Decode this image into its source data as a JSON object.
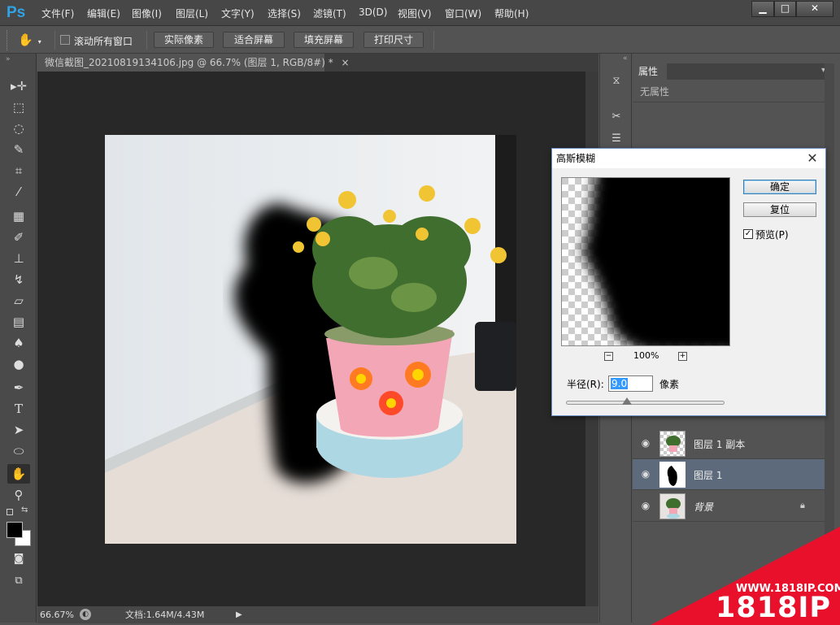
{
  "app": {
    "logo": "Ps",
    "menu": [
      "文件(F)",
      "编辑(E)",
      "图像(I)",
      "图层(L)",
      "文字(Y)",
      "选择(S)",
      "滤镜(T)",
      "3D(D)",
      "视图(V)",
      "窗口(W)",
      "帮助(H)"
    ],
    "window_buttons": {
      "minimize": "▁",
      "maximize": "□",
      "close": "✕"
    }
  },
  "options_bar": {
    "scroll_all_label": "滚动所有窗口",
    "scroll_all_checked": false,
    "actual_pixels": "实际像素",
    "fit_screen": "适合屏幕",
    "fill_screen": "填充屏幕",
    "print_size": "打印尺寸"
  },
  "tools": [
    "move-icon",
    "marquee-icon",
    "lasso-icon",
    "quick-select-icon",
    "crop-icon",
    "eyedropper-icon",
    "healing-icon",
    "brush-icon",
    "stamp-icon",
    "history-brush-icon",
    "eraser-icon",
    "gradient-icon",
    "blur-icon",
    "dodge-icon",
    "pen-icon",
    "type-icon",
    "path-select-icon",
    "shape-icon",
    "hand-icon",
    "zoom-icon"
  ],
  "document": {
    "tab_title": "微信截图_20210819134106.jpg @ 66.7% (图层 1, RGB/8#) *",
    "zoom": "66.67%",
    "doc_size": "文档:1.64M/4.43M"
  },
  "properties": {
    "tab": "属性",
    "empty": "无属性"
  },
  "layers": [
    {
      "name": "图层 1 副本",
      "selected": false,
      "locked": false
    },
    {
      "name": "图层 1",
      "selected": true,
      "locked": false
    },
    {
      "name": "背景",
      "selected": false,
      "locked": true
    }
  ],
  "dialog": {
    "title": "高斯模糊",
    "ok": "确定",
    "reset": "复位",
    "preview_label": "预览(P)",
    "preview_checked": true,
    "zoom_percent": "100%",
    "radius_label": "半径(R):",
    "radius_value": "9.0",
    "unit": "像素"
  },
  "watermark": {
    "url": "WWW.1818IP.COM",
    "brand": "1818IP"
  },
  "colors": {
    "accent": "#2fa3e6",
    "selected_layer": "#5d6a7c",
    "watermark_red": "#e8102a"
  }
}
